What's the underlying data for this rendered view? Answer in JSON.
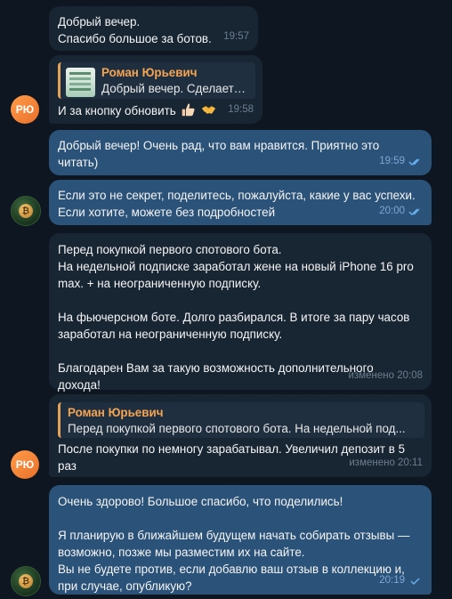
{
  "messages": [
    {
      "text": "Добрый вечер.\nСпасибо большое за ботов.",
      "time": "19:57"
    },
    {
      "reply_name": "Роман Юрьевич",
      "reply_text": "Добрый вечер.  Сделаете ...",
      "text": "И за кнопку обновить",
      "time": "19:58",
      "emojis": [
        "thumbs-up",
        "handshake"
      ]
    },
    {
      "text": "Добрый вечер! Очень рад, что вам нравится. Приятно это\nчитать)",
      "time": "19:59"
    },
    {
      "text": "Если это не секрет, поделитесь, пожалуйста, какие у вас успехи.\nЕсли хотите, можете без подробностей",
      "time": "20:00"
    },
    {
      "text": "Перед покупкой первого спотового бота.\nНа недельной подписке заработал жене на новый iPhone 16 pro\nmax. + на неограниченную подписку.\n\nНа фьючерсном боте. Долго разбирался. В итоге за пару часов\nзаработал на неограниченную подписку.\n\nБлагодарен Вам за такую возможность дополнительного\nдохода!",
      "time": "изменено 20:08"
    },
    {
      "reply_name": "Роман Юрьевич",
      "reply_text": "Перед покупкой первого спотового бота.  На недельной под...",
      "text": "После покупки по немногу зарабатывал. Увеличил депозит в 5\nраз",
      "time": "изменено 20:11"
    },
    {
      "text": "Очень здорово! Большое спасибо, что поделились!\n\nЯ планирую в ближайшем будущем начать собирать отзывы —\nвозможно, позже мы разместим их на сайте.\nВы не будете против, если добавлю ваш отзыв в коллекцию и,\nпри случае, опубликую?",
      "time": "20:19"
    }
  ],
  "avatars": {
    "contact_initials": "РЮ",
    "self_symbol": "₿"
  },
  "colors": {
    "background": "#0e1621",
    "incoming_bubble": "#182533",
    "outgoing_bubble": "#2b5278",
    "reply_accent": "#f5a452",
    "read_check": "#6ab3f3",
    "contact_avatar": "#f07f34"
  }
}
